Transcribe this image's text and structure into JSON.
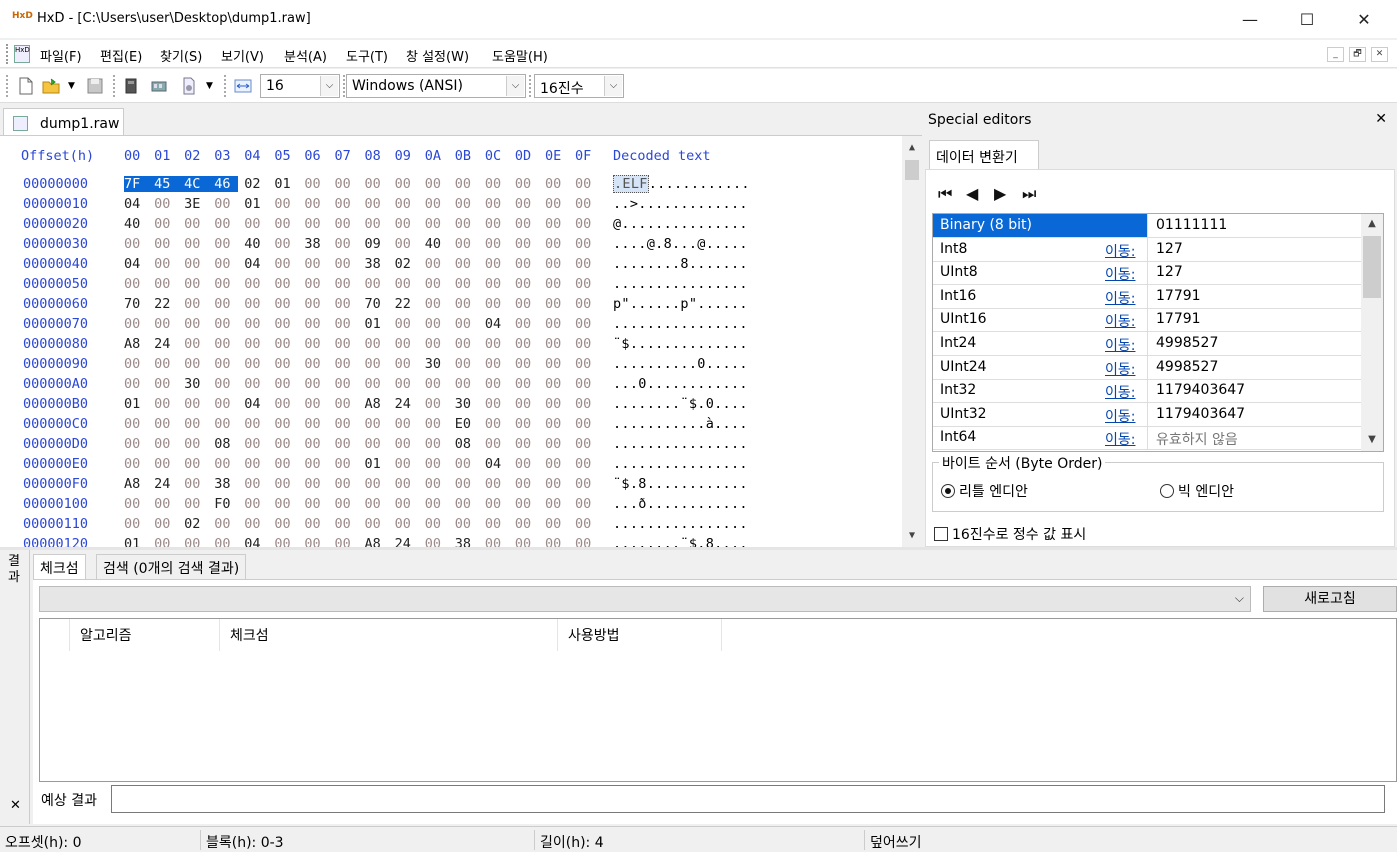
{
  "window": {
    "title": "HxD - [C:\\Users\\user\\Desktop\\dump1.raw]",
    "app_icon": "HxD",
    "controls": [
      "—",
      "☐",
      "✕"
    ]
  },
  "menu": [
    "파일(F)",
    "편집(E)",
    "찾기(S)",
    "보기(V)",
    "분석(A)",
    "도구(T)",
    "창 설정(W)",
    "도움말(H)"
  ],
  "mdi_controls": [
    "_",
    "🗗",
    "✕"
  ],
  "toolbar": {
    "bytes_per_row": "16",
    "charset": "Windows (ANSI)",
    "offset_base": "16진수",
    "combo_arrow": "⌵"
  },
  "document_tab": "dump1.raw",
  "hex": {
    "header_offset": "Offset(h)",
    "columns": [
      "00",
      "01",
      "02",
      "03",
      "04",
      "05",
      "06",
      "07",
      "08",
      "09",
      "0A",
      "0B",
      "0C",
      "0D",
      "0E",
      "0F"
    ],
    "header_text": "Decoded text",
    "selected_bytes": 4,
    "rows": [
      {
        "offset": "00000000",
        "bytes": [
          "7F",
          "45",
          "4C",
          "46",
          "02",
          "01",
          "00",
          "00",
          "00",
          "00",
          "00",
          "00",
          "00",
          "00",
          "00",
          "00"
        ],
        "text": ".ELF............"
      },
      {
        "offset": "00000010",
        "bytes": [
          "04",
          "00",
          "3E",
          "00",
          "01",
          "00",
          "00",
          "00",
          "00",
          "00",
          "00",
          "00",
          "00",
          "00",
          "00",
          "00"
        ],
        "text": "..>............."
      },
      {
        "offset": "00000020",
        "bytes": [
          "40",
          "00",
          "00",
          "00",
          "00",
          "00",
          "00",
          "00",
          "00",
          "00",
          "00",
          "00",
          "00",
          "00",
          "00",
          "00"
        ],
        "text": "@..............."
      },
      {
        "offset": "00000030",
        "bytes": [
          "00",
          "00",
          "00",
          "00",
          "40",
          "00",
          "38",
          "00",
          "09",
          "00",
          "40",
          "00",
          "00",
          "00",
          "00",
          "00"
        ],
        "text": "....@.8...@....."
      },
      {
        "offset": "00000040",
        "bytes": [
          "04",
          "00",
          "00",
          "00",
          "04",
          "00",
          "00",
          "00",
          "38",
          "02",
          "00",
          "00",
          "00",
          "00",
          "00",
          "00"
        ],
        "text": "........8......."
      },
      {
        "offset": "00000050",
        "bytes": [
          "00",
          "00",
          "00",
          "00",
          "00",
          "00",
          "00",
          "00",
          "00",
          "00",
          "00",
          "00",
          "00",
          "00",
          "00",
          "00"
        ],
        "text": "................"
      },
      {
        "offset": "00000060",
        "bytes": [
          "70",
          "22",
          "00",
          "00",
          "00",
          "00",
          "00",
          "00",
          "70",
          "22",
          "00",
          "00",
          "00",
          "00",
          "00",
          "00"
        ],
        "text": "p\"......p\"......"
      },
      {
        "offset": "00000070",
        "bytes": [
          "00",
          "00",
          "00",
          "00",
          "00",
          "00",
          "00",
          "00",
          "01",
          "00",
          "00",
          "00",
          "04",
          "00",
          "00",
          "00"
        ],
        "text": "................"
      },
      {
        "offset": "00000080",
        "bytes": [
          "A8",
          "24",
          "00",
          "00",
          "00",
          "00",
          "00",
          "00",
          "00",
          "00",
          "00",
          "00",
          "00",
          "00",
          "00",
          "00"
        ],
        "text": "¨$.............."
      },
      {
        "offset": "00000090",
        "bytes": [
          "00",
          "00",
          "00",
          "00",
          "00",
          "00",
          "00",
          "00",
          "00",
          "00",
          "30",
          "00",
          "00",
          "00",
          "00",
          "00"
        ],
        "text": "..........0....."
      },
      {
        "offset": "000000A0",
        "bytes": [
          "00",
          "00",
          "30",
          "00",
          "00",
          "00",
          "00",
          "00",
          "00",
          "00",
          "00",
          "00",
          "00",
          "00",
          "00",
          "00"
        ],
        "text": "...0............"
      },
      {
        "offset": "000000B0",
        "bytes": [
          "01",
          "00",
          "00",
          "00",
          "04",
          "00",
          "00",
          "00",
          "A8",
          "24",
          "00",
          "30",
          "00",
          "00",
          "00",
          "00"
        ],
        "text": "........¨$.0...."
      },
      {
        "offset": "000000C0",
        "bytes": [
          "00",
          "00",
          "00",
          "00",
          "00",
          "00",
          "00",
          "00",
          "00",
          "00",
          "00",
          "E0",
          "00",
          "00",
          "00",
          "00"
        ],
        "text": "...........à...."
      },
      {
        "offset": "000000D0",
        "bytes": [
          "00",
          "00",
          "00",
          "08",
          "00",
          "00",
          "00",
          "00",
          "00",
          "00",
          "00",
          "08",
          "00",
          "00",
          "00",
          "00"
        ],
        "text": "................"
      },
      {
        "offset": "000000E0",
        "bytes": [
          "00",
          "00",
          "00",
          "00",
          "00",
          "00",
          "00",
          "00",
          "01",
          "00",
          "00",
          "00",
          "04",
          "00",
          "00",
          "00"
        ],
        "text": "................"
      },
      {
        "offset": "000000F0",
        "bytes": [
          "A8",
          "24",
          "00",
          "38",
          "00",
          "00",
          "00",
          "00",
          "00",
          "00",
          "00",
          "00",
          "00",
          "00",
          "00",
          "00"
        ],
        "text": "¨$.8............"
      },
      {
        "offset": "00000100",
        "bytes": [
          "00",
          "00",
          "00",
          "F0",
          "00",
          "00",
          "00",
          "00",
          "00",
          "00",
          "00",
          "00",
          "00",
          "00",
          "00",
          "00"
        ],
        "text": "...ð............"
      },
      {
        "offset": "00000110",
        "bytes": [
          "00",
          "00",
          "02",
          "00",
          "00",
          "00",
          "00",
          "00",
          "00",
          "00",
          "00",
          "00",
          "00",
          "00",
          "00",
          "00"
        ],
        "text": "................"
      },
      {
        "offset": "00000120",
        "bytes": [
          "01",
          "00",
          "00",
          "00",
          "04",
          "00",
          "00",
          "00",
          "A8",
          "24",
          "00",
          "38",
          "00",
          "00",
          "00",
          "00"
        ],
        "text": "........¨$.8...."
      }
    ]
  },
  "special_editors": {
    "title": "Special editors",
    "close": "✕",
    "tab": "데이터 변환기",
    "nav": [
      "⏮",
      "◀",
      "▶",
      "⏭"
    ],
    "rows": [
      {
        "name": "Binary (8 bit)",
        "go": "",
        "value": "01111111"
      },
      {
        "name": "Int8",
        "go": "이동:",
        "value": "127"
      },
      {
        "name": "UInt8",
        "go": "이동:",
        "value": "127"
      },
      {
        "name": "Int16",
        "go": "이동:",
        "value": "17791"
      },
      {
        "name": "UInt16",
        "go": "이동:",
        "value": "17791"
      },
      {
        "name": "Int24",
        "go": "이동:",
        "value": "4998527"
      },
      {
        "name": "UInt24",
        "go": "이동:",
        "value": "4998527"
      },
      {
        "name": "Int32",
        "go": "이동:",
        "value": "1179403647"
      },
      {
        "name": "UInt32",
        "go": "이동:",
        "value": "1179403647"
      },
      {
        "name": "Int64",
        "go": "이동:",
        "value": "유효하지 않음"
      }
    ],
    "byte_order_label": "바이트 순서 (Byte Order)",
    "little_endian": "리틀 엔디안",
    "big_endian": "빅 엔디안",
    "selected_order": "little",
    "hex_int_checkbox": "16진수로 정수 값 표시",
    "hex_int_checked": false
  },
  "results": {
    "side_label": "결과",
    "close": "✕",
    "tabs": [
      "체크섬",
      "검색 (0개의 검색 결과)"
    ],
    "refresh_button": "새로고침",
    "columns": [
      "알고리즘",
      "체크섬",
      "사용방법"
    ],
    "expected_label": "예상 결과",
    "expected_value": ""
  },
  "status": {
    "offset": "오프셋(h): 0",
    "block": "블록(h): 0-3",
    "length": "길이(h): 4",
    "mode": "덮어쓰기"
  }
}
